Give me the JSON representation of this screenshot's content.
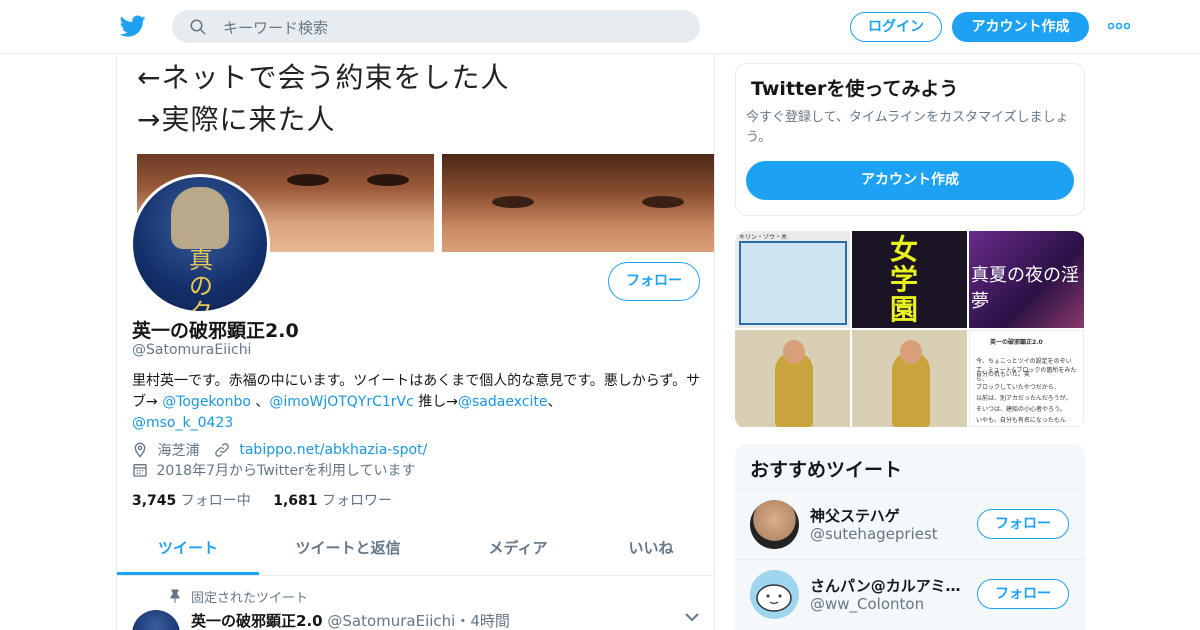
{
  "colors": {
    "accent": "#1da1f2",
    "link": "#1b95e0",
    "muted": "#657786",
    "border": "#e6ecf0"
  },
  "header": {
    "search_placeholder": "キーワード検索",
    "login": "ログイン",
    "signup": "アカウント作成"
  },
  "banner": {
    "line1": "←ネットで会う約束をした人",
    "line2": "→実際に来た人"
  },
  "avatar": {
    "text": "真のクソ"
  },
  "profile": {
    "follow": "フォロー",
    "name": "英一の破邪顕正2.0",
    "handle": "@SatomuraEiichi",
    "bio_1": "里村英一です。赤福の中にいます。ツイートはあくまで個人的な意見です。悪しからず。サブ→ ",
    "bio_link1": "@Togekonbo",
    "bio_2": " 、",
    "bio_link2": "@imoWjOTQYrC1rVc",
    "bio_3": " 推し→",
    "bio_link3": "@sadaexcite",
    "bio_4": "、",
    "bio_link4": "@mso_k_0423",
    "location": "海芝浦",
    "url": "tabippo.net/abkhazia-spot/",
    "joined": "2018年7月からTwitterを利用しています",
    "following_count": "3,745",
    "following_label": "フォロー中",
    "followers_count": "1,681",
    "followers_label": "フォロワー"
  },
  "tabs": [
    {
      "label": "ツイート"
    },
    {
      "label": "ツイートと返信"
    },
    {
      "label": "メディア"
    },
    {
      "label": "いいね"
    }
  ],
  "pinned_tweet": {
    "pinned_label": "固定されたツイート",
    "name": "英一の破邪顕正2.0",
    "handle": "@SatomuraEiichi",
    "time": "・4時間"
  },
  "signup_card": {
    "title": "Twitterを使ってみよう",
    "desc": "今すぐ登録して、タイムラインをカスタマイズしましょう。",
    "button": "アカウント作成"
  },
  "media": {
    "t1_caption": "キリン・ゾウ・木",
    "t2_text": "女学園",
    "t3_text": "真夏の夜の淫夢",
    "t6_title": "英一の破邪顕正2.0",
    "t6_lines": [
      "今、ちょこっとツイの設定をのぞいて、ミュート&ブロックの箇所をみたら、",
      "自分の仇もいた。笑",
      "ブロックしていたやつだから、",
      "以前は、別アカだったんだろうが。",
      "そいつは、建船の小心者やろう。",
      "いやも、自分も有名になったもん"
    ]
  },
  "recommend": {
    "title": "おすすめツイート",
    "users": [
      {
        "name": "神父ステハゲ",
        "handle": "@sutehagepriest",
        "follow": "フォロー"
      },
      {
        "name": "さんパン@カルアミルク",
        "handle": "@ww_Colonton",
        "follow": "フォロー"
      }
    ]
  }
}
